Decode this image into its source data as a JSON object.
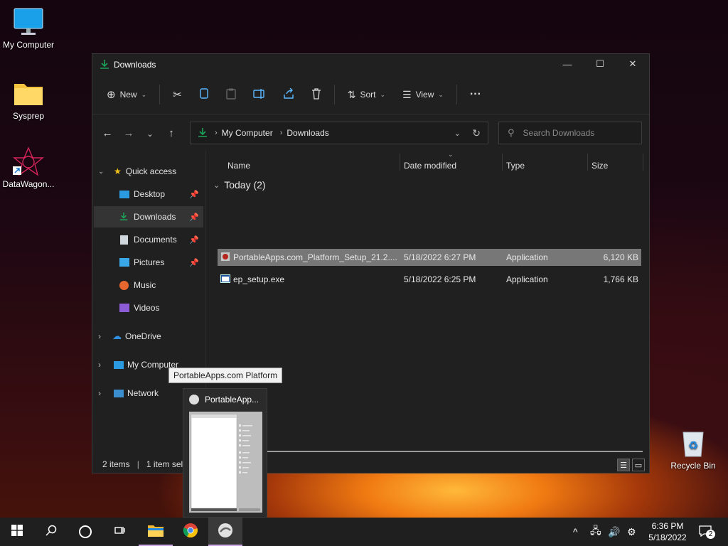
{
  "desktop": {
    "icons": [
      {
        "label": "My Computer"
      },
      {
        "label": "Sysprep"
      },
      {
        "label": "DataWagon..."
      },
      {
        "label": "Recycle Bin"
      }
    ]
  },
  "window": {
    "title": "Downloads",
    "toolbar": {
      "new_label": "New",
      "sort_label": "Sort",
      "view_label": "View"
    },
    "address": {
      "crumbs": [
        "My Computer",
        "Downloads"
      ]
    },
    "search": {
      "placeholder": "Search Downloads"
    },
    "sidebar": {
      "quick_access": "Quick access",
      "items": [
        {
          "label": "Desktop",
          "pinned": true
        },
        {
          "label": "Downloads",
          "pinned": true
        },
        {
          "label": "Documents",
          "pinned": true
        },
        {
          "label": "Pictures",
          "pinned": true
        },
        {
          "label": "Music",
          "pinned": false
        },
        {
          "label": "Videos",
          "pinned": false
        }
      ],
      "onedrive": "OneDrive",
      "my_computer": "My Computer",
      "network": "Network"
    },
    "columns": {
      "name": "Name",
      "date": "Date modified",
      "type": "Type",
      "size": "Size"
    },
    "group_label": "Today (2)",
    "files": [
      {
        "name": "PortableApps.com_Platform_Setup_21.2....",
        "date": "5/18/2022 6:27 PM",
        "type": "Application",
        "size": "6,120 KB",
        "selected": true
      },
      {
        "name": "ep_setup.exe",
        "date": "5/18/2022 6:25 PM",
        "type": "Application",
        "size": "1,766 KB",
        "selected": false
      }
    ],
    "status": {
      "items": "2 items",
      "selected": "1 item sele"
    }
  },
  "tooltip": "PortableApps.com Platform",
  "thumbnail": {
    "title": "PortableApp..."
  },
  "taskbar": {
    "clock_time": "6:36 PM",
    "clock_date": "5/18/2022",
    "notifications": "2"
  },
  "colors": {
    "accent": "#1ba35a",
    "selection": "#777777",
    "taskbar": "#1f1f1f"
  }
}
